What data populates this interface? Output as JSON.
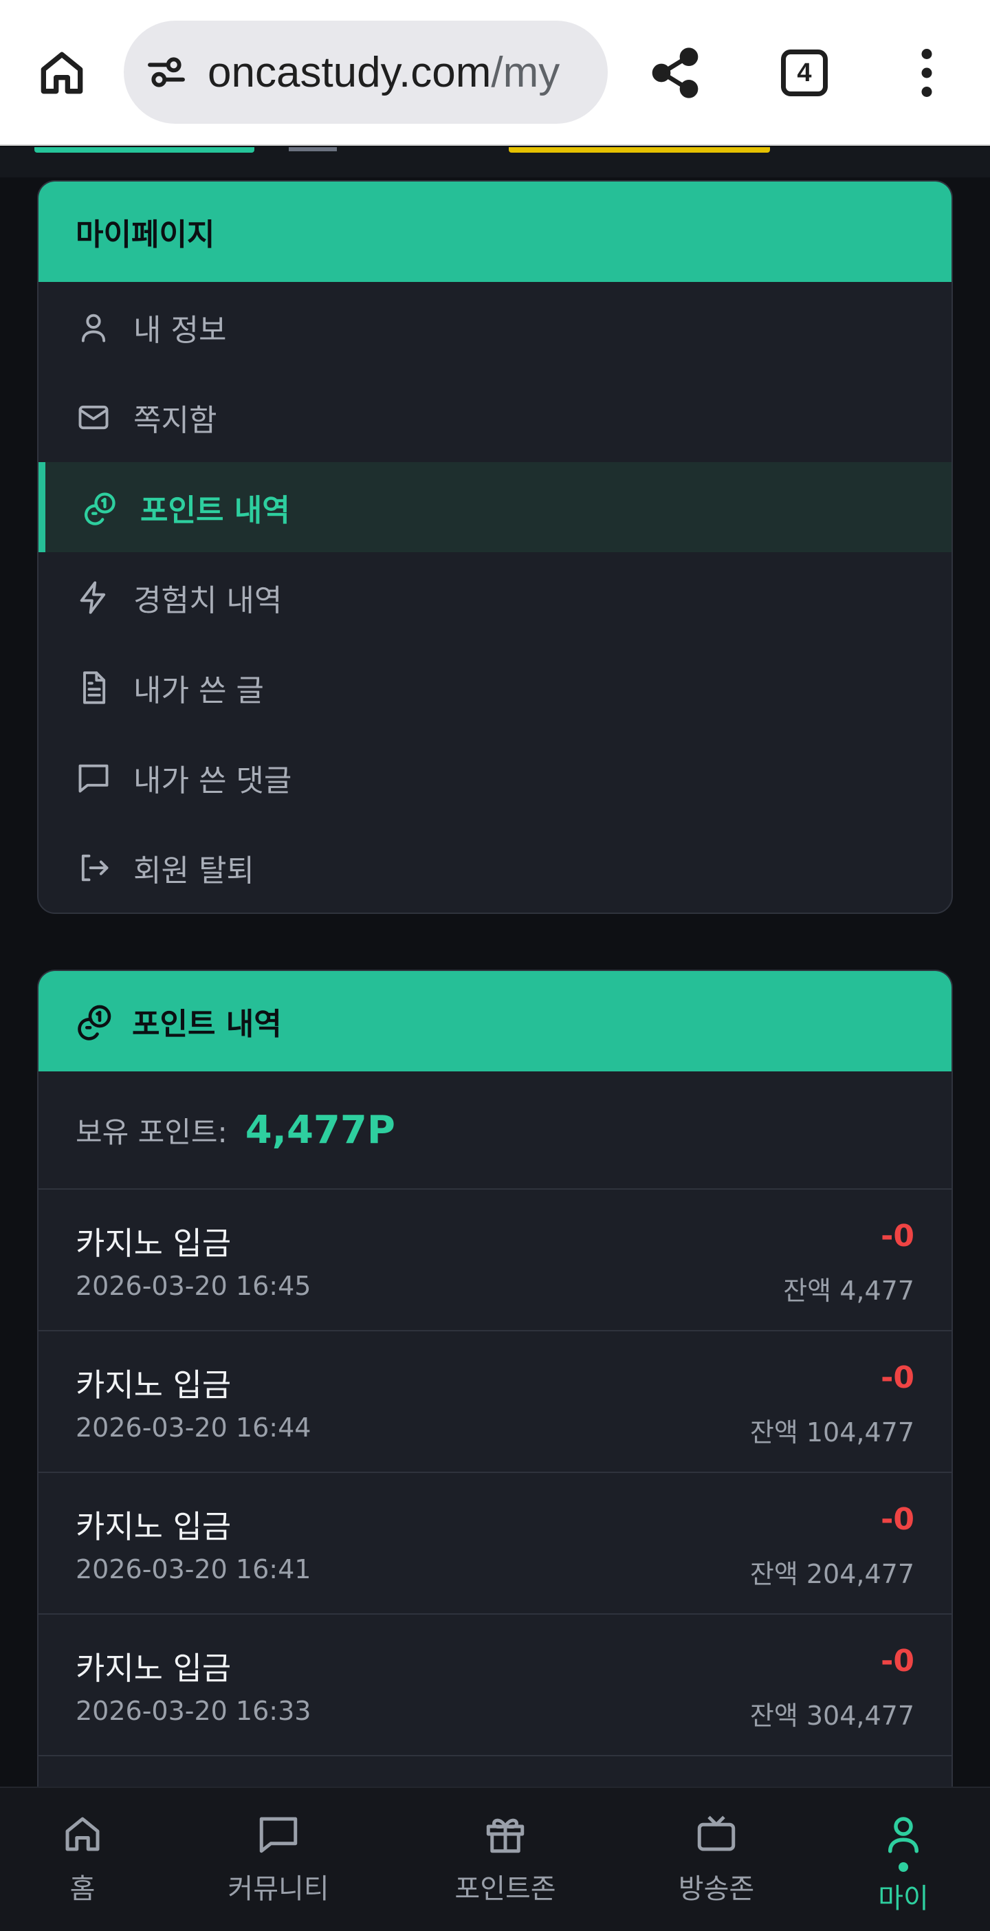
{
  "browser": {
    "url_host": "oncastudy.com",
    "url_path": "/my",
    "tab_count": "4"
  },
  "sidebar": {
    "title": "마이페이지",
    "items": [
      {
        "label": "내 정보",
        "icon": "user-icon"
      },
      {
        "label": "쪽지함",
        "icon": "mail-icon"
      },
      {
        "label": "포인트 내역",
        "icon": "coins-icon",
        "active": true
      },
      {
        "label": "경험치 내역",
        "icon": "lightning-icon"
      },
      {
        "label": "내가 쓴 글",
        "icon": "document-icon"
      },
      {
        "label": "내가 쓴 댓글",
        "icon": "comment-icon"
      },
      {
        "label": "회원 탈퇴",
        "icon": "logout-icon"
      }
    ]
  },
  "points": {
    "title": "포인트 내역",
    "balance_label": "보유 포인트:",
    "balance_value": "4,477P",
    "transactions": [
      {
        "title": "카지노 입금",
        "date": "2026-03-20 16:45",
        "amount": "-0",
        "balance": "잔액 4,477"
      },
      {
        "title": "카지노 입금",
        "date": "2026-03-20 16:44",
        "amount": "-0",
        "balance": "잔액 104,477"
      },
      {
        "title": "카지노 입금",
        "date": "2026-03-20 16:41",
        "amount": "-0",
        "balance": "잔액 204,477"
      },
      {
        "title": "카지노 입금",
        "date": "2026-03-20 16:33",
        "amount": "-0",
        "balance": "잔액 304,477"
      }
    ]
  },
  "bottom_nav": {
    "items": [
      {
        "label": "홈",
        "icon": "home-icon"
      },
      {
        "label": "커뮤니티",
        "icon": "chat-icon"
      },
      {
        "label": "포인트존",
        "icon": "gift-icon"
      },
      {
        "label": "방송존",
        "icon": "tv-icon"
      },
      {
        "label": "마이",
        "icon": "user-icon",
        "active": true
      }
    ]
  },
  "colors": {
    "accent": "#26bf97",
    "negative": "#ef4444",
    "card_bg": "#1c1f27",
    "page_bg": "#0e1014"
  }
}
